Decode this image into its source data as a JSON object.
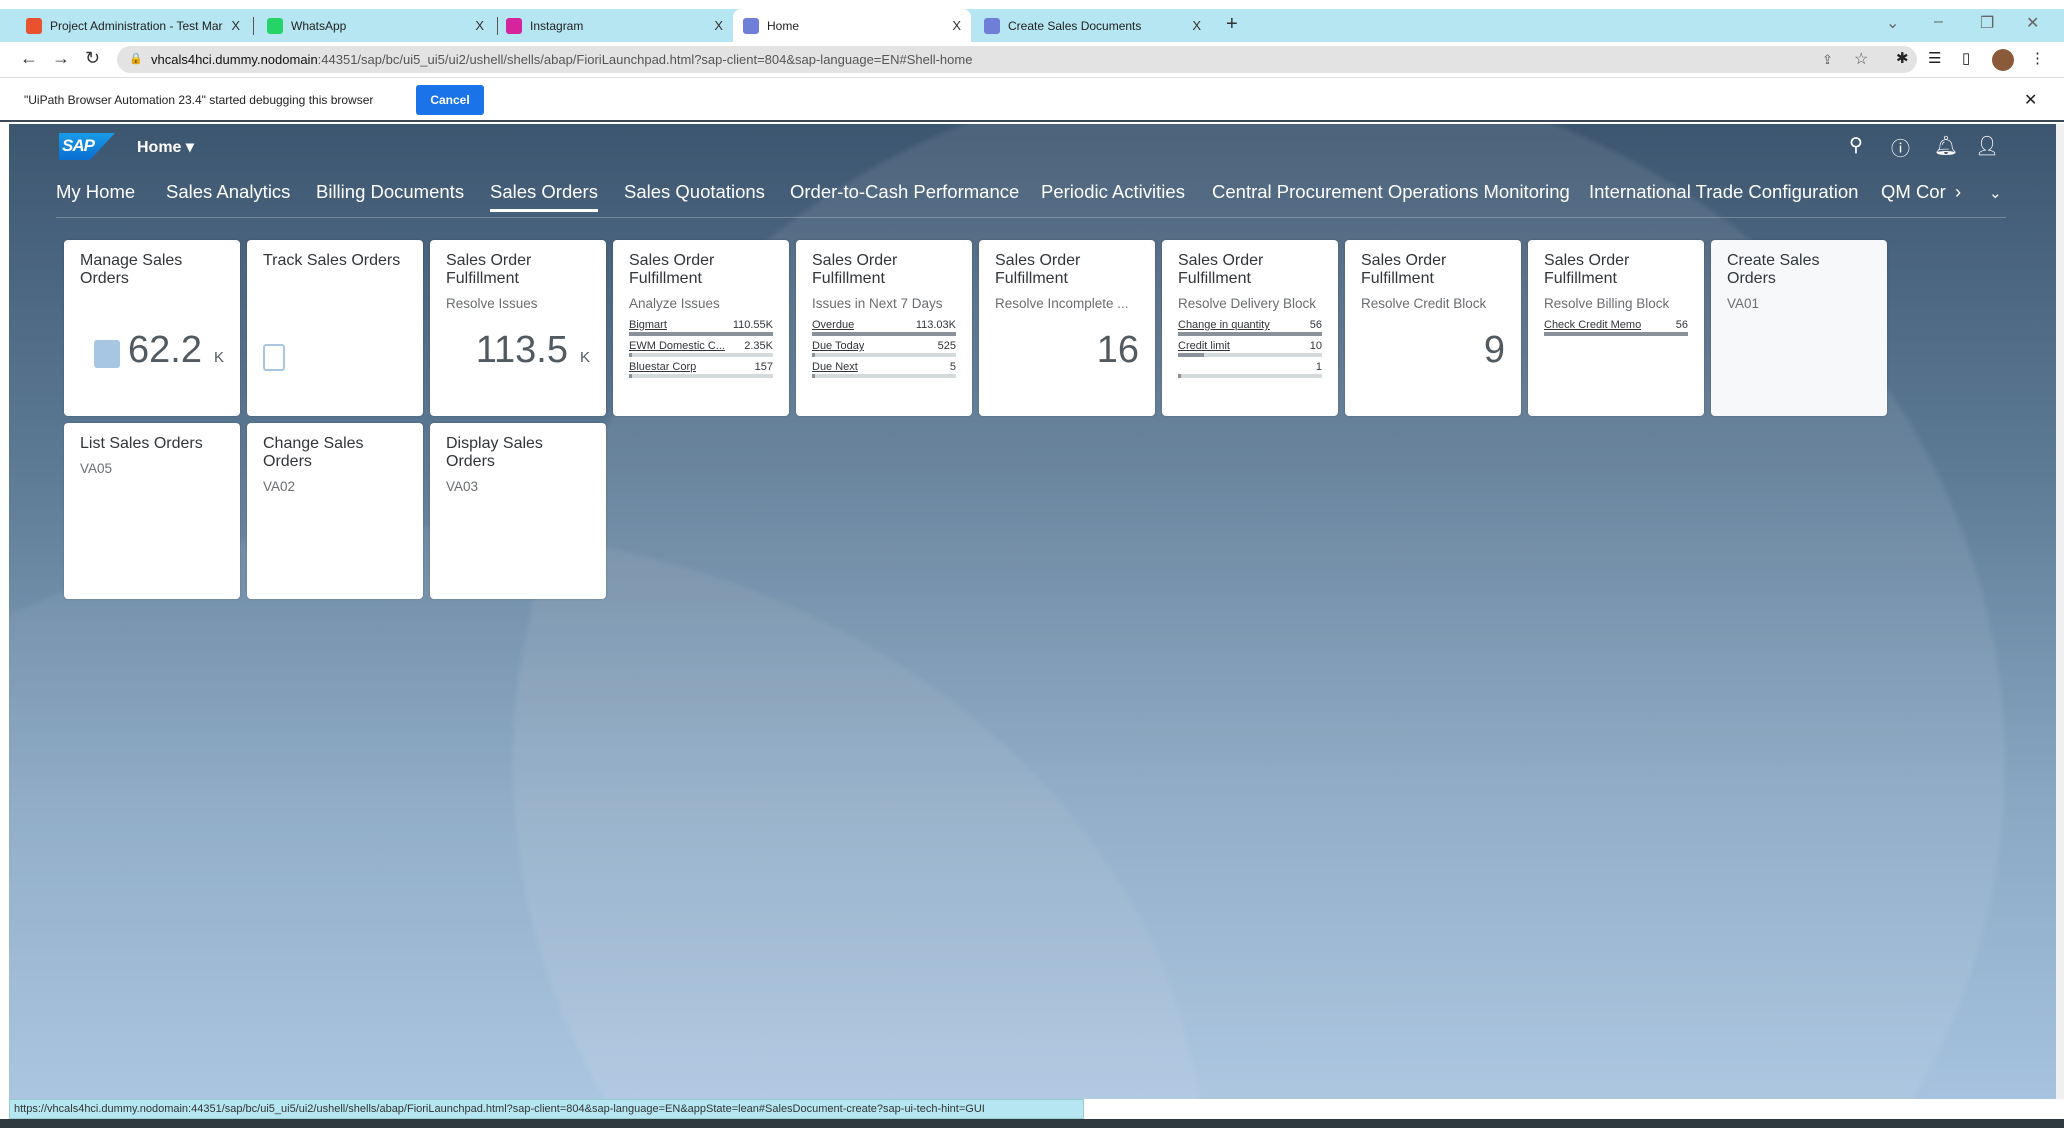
{
  "browser": {
    "tabs": [
      {
        "label": "Project Administration - Test Mar",
        "icon_color": "#e8522e",
        "active": false
      },
      {
        "label": "WhatsApp",
        "icon_color": "#25d366",
        "active": false
      },
      {
        "label": "Instagram",
        "icon_color": "#d6249f",
        "active": false
      },
      {
        "label": "Home",
        "icon_color": "#6f7fd8",
        "active": true
      },
      {
        "label": "Create Sales Documents",
        "icon_color": "#6f7fd8",
        "active": false
      }
    ],
    "tab_close": "X",
    "new_tab": "+",
    "address_host": "vhcals4hci.dummy.nodomain",
    "address_path": ":44351/sap/bc/ui5_ui5/ui2/ushell/shells/abap/FioriLaunchpad.html?sap-client=804&sap-language=EN#Shell-home",
    "infobar_message": "\"UiPath Browser Automation 23.4\" started debugging this browser",
    "infobar_cancel": "Cancel",
    "status_url": "https://vhcals4hci.dummy.nodomain:44351/sap/bc/ui5_ui5/ui2/ushell/shells/abap/FioriLaunchpad.html?sap-client=804&sap-language=EN&appState=lean#SalesDocument-create?sap-ui-tech-hint=GUI"
  },
  "shell": {
    "logo": "SAP",
    "home_menu": "Home ▾"
  },
  "nav": [
    "My Home",
    "Sales Analytics",
    "Billing Documents",
    "Sales Orders",
    "Sales Quotations",
    "Order-to-Cash Performance",
    "Periodic Activities",
    "Central Procurement Operations Monitoring",
    "International Trade Configuration",
    "QM Cor"
  ],
  "nav_selected": "Sales Orders",
  "tiles": [
    {
      "title": "Manage Sales Orders",
      "kpi": "62.2",
      "unit": "K",
      "icon": "sales-order-icon"
    },
    {
      "title": "Track Sales Orders",
      "icon": "checklist-icon"
    },
    {
      "title": "Sales Order Fulfillment",
      "subtitle": "Resolve Issues",
      "kpi": "113.5",
      "unit": "K"
    },
    {
      "title": "Sales Order Fulfillment",
      "subtitle": "Analyze Issues",
      "bars": [
        {
          "label": "Bigmart",
          "value": "110.55K",
          "pct": 100
        },
        {
          "label": "EWM Domestic C...",
          "value": "2.35K",
          "pct": 2
        },
        {
          "label": "Bluestar Corp",
          "value": "157",
          "pct": 1
        }
      ]
    },
    {
      "title": "Sales Order Fulfillment",
      "subtitle": "Issues in Next 7 Days",
      "bars": [
        {
          "label": "Overdue",
          "value": "113.03K",
          "pct": 100
        },
        {
          "label": "Due Today",
          "value": "525",
          "pct": 1
        },
        {
          "label": "Due Next",
          "value": "5",
          "pct": 1
        }
      ]
    },
    {
      "title": "Sales Order Fulfillment",
      "subtitle": "Resolve Incomplete ...",
      "kpi": "16"
    },
    {
      "title": "Sales Order Fulfillment",
      "subtitle": "Resolve Delivery Block",
      "bars": [
        {
          "label": "Change in quantity",
          "value": "56",
          "pct": 100
        },
        {
          "label": "Credit limit",
          "value": "10",
          "pct": 18
        },
        {
          "label": "",
          "value": "1",
          "pct": 2
        }
      ]
    },
    {
      "title": "Sales Order Fulfillment",
      "subtitle": "Resolve Credit Block",
      "kpi": "9"
    },
    {
      "title": "Sales Order Fulfillment",
      "subtitle": "Resolve Billing Block",
      "bars": [
        {
          "label": "Check Credit Memo",
          "value": "56",
          "pct": 100
        }
      ]
    },
    {
      "title": "Create Sales Orders",
      "subtitle": "VA01",
      "light": true
    },
    {
      "title": "List Sales Orders",
      "subtitle": "VA05"
    },
    {
      "title": "Change Sales Orders",
      "subtitle": "VA02"
    },
    {
      "title": "Display Sales Orders",
      "subtitle": "VA03"
    }
  ]
}
